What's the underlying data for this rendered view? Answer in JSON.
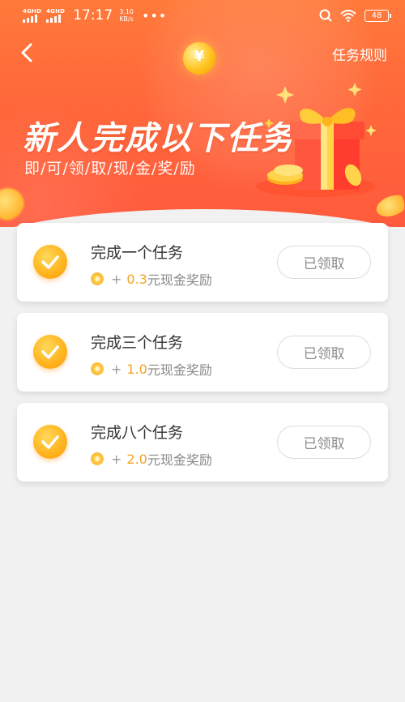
{
  "status_bar": {
    "network_1": "4GHD",
    "network_2": "4GHD",
    "time": "17:17",
    "speed_value": "3.10",
    "speed_unit": "KB/s",
    "more": "•••",
    "battery": "48"
  },
  "nav": {
    "back_icon": "chevron-left-icon",
    "rules_label": "任务规则"
  },
  "hero": {
    "title": "新人完成以下任务",
    "subtitle": "即/可/领/取/现/金/奖/励"
  },
  "tasks": [
    {
      "title": "完成一个任务",
      "plus": "+",
      "amount": "0.3",
      "reward_suffix": "元现金奖励",
      "button_label": "已领取"
    },
    {
      "title": "完成三个任务",
      "plus": "+",
      "amount": "1.0",
      "reward_suffix": "元现金奖励",
      "button_label": "已领取"
    },
    {
      "title": "完成八个任务",
      "plus": "+",
      "amount": "2.0",
      "reward_suffix": "元现金奖励",
      "button_label": "已领取"
    }
  ],
  "colors": {
    "hero_gradient_top": "#ff7a3a",
    "hero_gradient_bottom": "#ff5a3d",
    "amount": "#f4a321",
    "badge": "#ffb21c",
    "background": "#f1f1f1"
  }
}
